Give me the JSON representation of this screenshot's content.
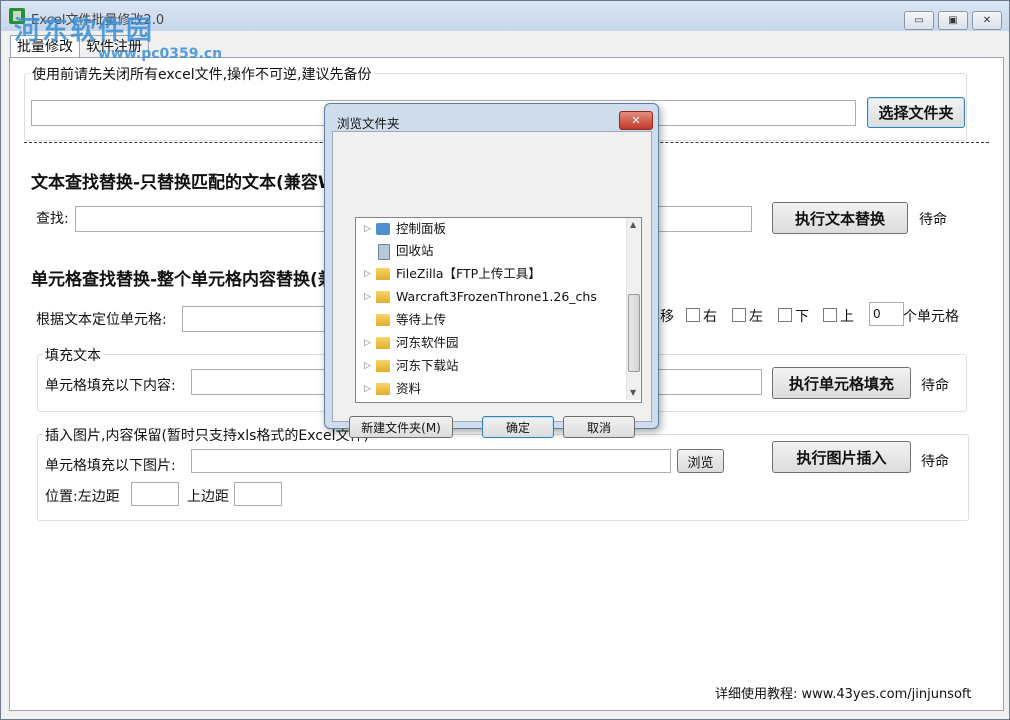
{
  "window": {
    "title": "Excel文件批量修改2.0",
    "watermark_logo": "河东软件园",
    "watermark_url": "www.pc0359.cn",
    "controls": {
      "minimize": "▭",
      "maximize": "▣",
      "close": "✕"
    }
  },
  "tabs": [
    {
      "label": "批量修改",
      "active": true
    },
    {
      "label": "软件注册",
      "active": false
    }
  ],
  "backup_group": {
    "caption": "使用前请先关闭所有excel文件,操作不可逆,建议先备份",
    "path_value": "",
    "select_folder_button": "选择文件夹"
  },
  "text_replace": {
    "heading": "文本查找替换-只替换匹配的文本(兼容W",
    "find_label": "查找:",
    "execute_button": "执行文本替换",
    "status": "待命"
  },
  "cell_replace": {
    "heading": "单元格查找替换-整个单元格内容替换(兼",
    "locate_label": "根据文本定位单元格:",
    "shift_label": "移",
    "directions": [
      "右",
      "左",
      "下",
      "上"
    ],
    "offset_value": "0",
    "offset_unit": "个单元格",
    "fill_group_caption": "填充文本",
    "fill_label": "单元格填充以下内容:",
    "execute_button": "执行单元格填充",
    "status": "待命"
  },
  "image_insert": {
    "caption": "插入图片,内容保留(暂时只支持xls格式的Excel文件)",
    "fill_label": "单元格填充以下图片:",
    "browse_button": "浏览",
    "position_label": "位置:左边距",
    "top_margin_label": "上边距",
    "execute_button": "执行图片插入",
    "status": "待命"
  },
  "footer": {
    "tutorial": "详细使用教程: www.43yes.com/jinjunsoft"
  },
  "dialog": {
    "title": "浏览文件夹",
    "close": "✕",
    "tree_items": [
      {
        "label": "控制面板",
        "icon": "control-panel-icon",
        "expandable": true
      },
      {
        "label": "回收站",
        "icon": "recycle-bin-icon",
        "expandable": false
      },
      {
        "label": "FileZilla【FTP上传工具】",
        "icon": "folder-icon",
        "expandable": true
      },
      {
        "label": "Warcraft3FrozenThrone1.26_chs",
        "icon": "folder-icon",
        "expandable": true
      },
      {
        "label": "等待上传",
        "icon": "folder-icon",
        "expandable": false
      },
      {
        "label": "河东软件园",
        "icon": "folder-icon",
        "expandable": true
      },
      {
        "label": "河东下载站",
        "icon": "folder-icon",
        "expandable": true
      },
      {
        "label": "资料",
        "icon": "folder-icon",
        "expandable": true
      }
    ],
    "new_folder_button": "新建文件夹(M)",
    "ok_button": "确定",
    "cancel_button": "取消"
  }
}
